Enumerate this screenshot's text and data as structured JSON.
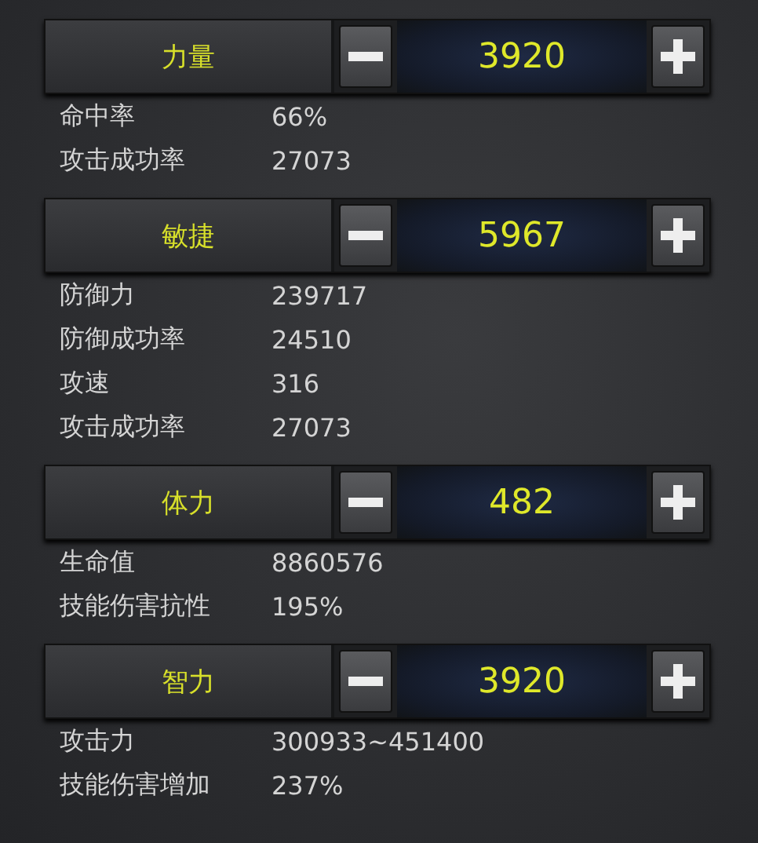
{
  "attributes": [
    {
      "name": "力量",
      "value": "3920",
      "stats": [
        {
          "label": "命中率",
          "value": "66%"
        },
        {
          "label": "攻击成功率",
          "value": "27073"
        }
      ]
    },
    {
      "name": "敏捷",
      "value": "5967",
      "stats": [
        {
          "label": "防御力",
          "value": "239717"
        },
        {
          "label": "防御成功率",
          "value": "24510"
        },
        {
          "label": "攻速",
          "value": "316"
        },
        {
          "label": "攻击成功率",
          "value": "27073"
        }
      ]
    },
    {
      "name": "体力",
      "value": "482",
      "stats": [
        {
          "label": "生命值",
          "value": "8860576"
        },
        {
          "label": "技能伤害抗性",
          "value": "195%"
        }
      ]
    },
    {
      "name": "智力",
      "value": "3920",
      "stats": [
        {
          "label": "攻击力",
          "value": "300933~451400"
        },
        {
          "label": "技能伤害增加",
          "value": "237%"
        }
      ]
    }
  ]
}
